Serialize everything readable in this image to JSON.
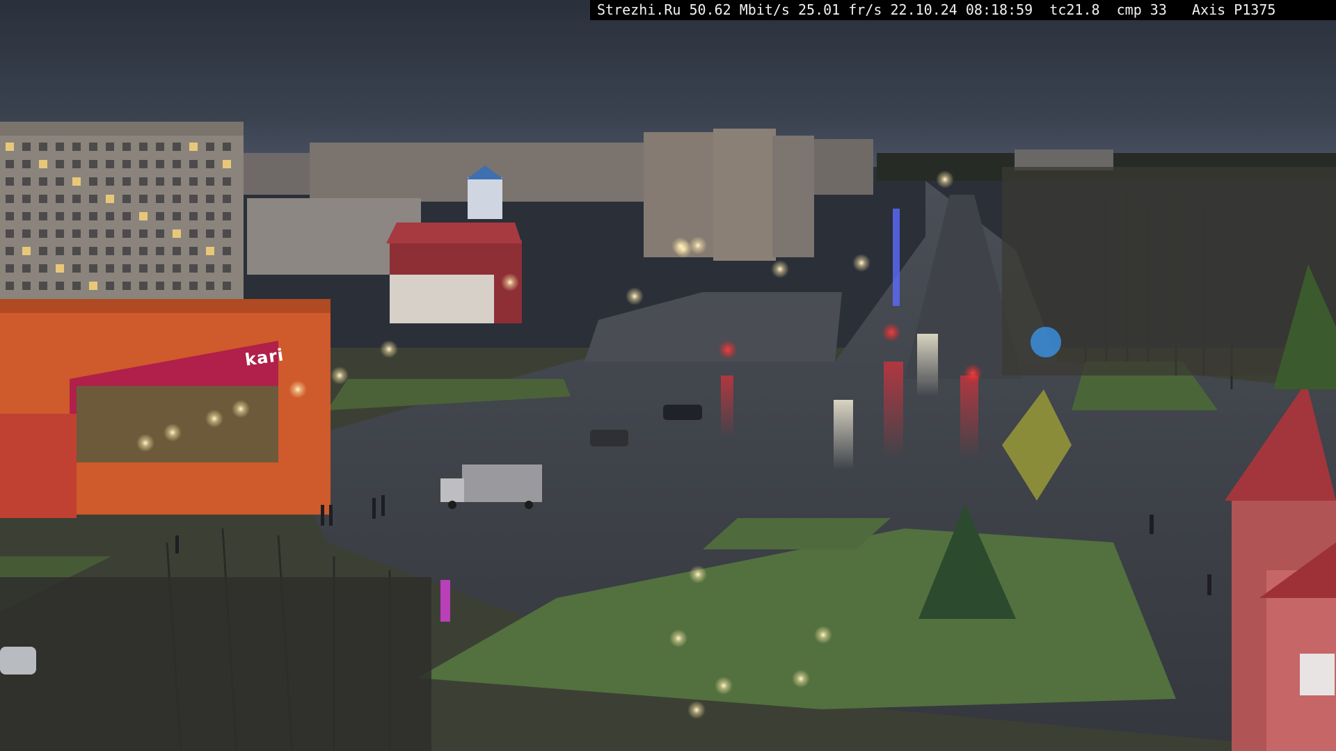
{
  "osd": {
    "site": "Strezhi.Ru",
    "bitrate": "50.62 Mbit/s",
    "fps": "25.01 fr/s",
    "date": "22.10.24",
    "time": "08:18:59",
    "tc": "tc21.8",
    "cmp": "cmp 33",
    "camera": "Axis P1375"
  },
  "store_sign": {
    "brand": "kari"
  },
  "colors": {
    "sky": "#2c3340",
    "osd_bg": "#000000",
    "osd_text": "#f2f2f2",
    "road_wet": "#3a3f47",
    "grass": "#4d6a3a",
    "store_orange": "#d85a2a",
    "kari_magenta": "#b0204a"
  }
}
